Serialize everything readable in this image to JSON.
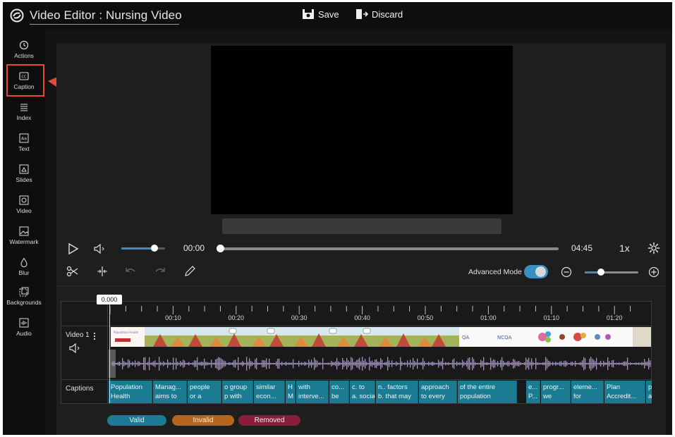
{
  "app": {
    "title": "Video Editor : Nursing Video",
    "save_label": "Save",
    "discard_label": "Discard"
  },
  "sidebar": {
    "items": [
      {
        "label": "Actions",
        "icon": "history-icon"
      },
      {
        "label": "Caption",
        "icon": "cc-icon",
        "active": true
      },
      {
        "label": "Index",
        "icon": "list-icon"
      },
      {
        "label": "Text",
        "icon": "text-aa-icon"
      },
      {
        "label": "Slides",
        "icon": "slides-icon"
      },
      {
        "label": "Video",
        "icon": "video-icon"
      },
      {
        "label": "Watermark",
        "icon": "image-icon"
      },
      {
        "label": "Blur",
        "icon": "droplet-icon"
      },
      {
        "label": "Backgrounds",
        "icon": "background-icon"
      },
      {
        "label": "Audio",
        "icon": "audio-icon"
      }
    ]
  },
  "player": {
    "current_time": "00:00",
    "total_time": "04:45",
    "speed": "1x",
    "volume": 0.75,
    "progress": 0
  },
  "tools": {
    "advanced_mode_label": "Advanced Mode",
    "advanced_mode_on": true,
    "zoom": 0.3
  },
  "timeline": {
    "playhead": "0.000",
    "ruler_labels": [
      "00:10",
      "00:20",
      "00:30",
      "00:40",
      "00:50",
      "01:00",
      "01:10",
      "01:20"
    ],
    "video_track_label": "Video 1",
    "captions_track_label": "Captions",
    "captions": [
      {
        "l1": "Population",
        "l2": "Health"
      },
      {
        "l1": "Manag...",
        "l2": "aims to"
      },
      {
        "l1": "people",
        "l2": "or a"
      },
      {
        "l1": "o group",
        "l2": "p with"
      },
      {
        "l1": "similar",
        "l2": "econ..."
      },
      {
        "l1": "H",
        "l2": "M"
      },
      {
        "l1": "with",
        "l2": "interve..."
      },
      {
        "l1": "co...",
        "l2": "be"
      },
      {
        "l1": "c. to",
        "l2": "a. social"
      },
      {
        "l1": "n.. factors",
        "l2": "b. that may"
      },
      {
        "l1": "approach",
        "l2": "to every"
      },
      {
        "l1": "of the entire",
        "l2": "population"
      },
      {
        "l1": "e...",
        "l2": "P..."
      },
      {
        "l1": "progr...",
        "l2": "we"
      },
      {
        "l1": "eleme...",
        "l2": "for"
      },
      {
        "l1": "Plan",
        "l2": "Accredit..."
      },
      {
        "l1": "p",
        "l2": "a"
      }
    ]
  },
  "legend": {
    "valid_label": "Valid",
    "invalid_label": "Invalid",
    "removed_label": "Removed"
  },
  "colors": {
    "accent": "#3a8ec0",
    "caption_chip": "#1a7b92",
    "valid": "#1a7b92",
    "invalid": "#b5651d",
    "removed": "#8a1c3c",
    "annotation": "#e5483a"
  }
}
